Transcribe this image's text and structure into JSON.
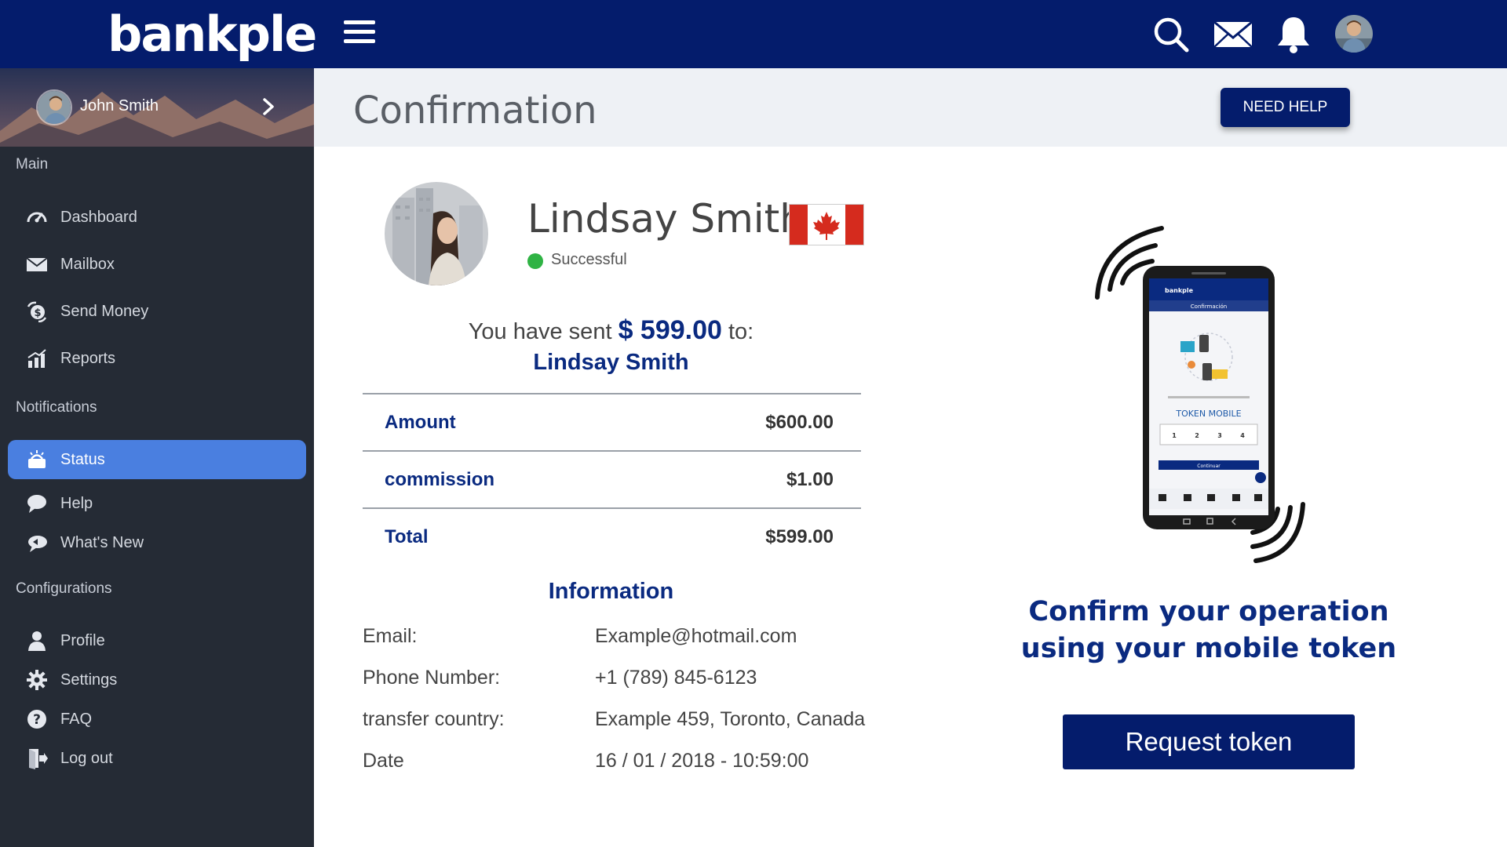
{
  "brand": {
    "logo_text": "bankple"
  },
  "topbar": {
    "icons": [
      "search-icon",
      "mail-icon",
      "bell-icon",
      "user-avatar"
    ]
  },
  "sidebar": {
    "user_name": "John Smith",
    "sections": {
      "main": "Main",
      "notifications": "Notifications",
      "configurations": "Configurations"
    },
    "items": [
      {
        "label": "Dashboard",
        "icon": "speedometer-icon"
      },
      {
        "label": "Mailbox",
        "icon": "mail-icon"
      },
      {
        "label": "Send Money",
        "icon": "money-transfer-icon"
      },
      {
        "label": "Reports",
        "icon": "bar-chart-icon"
      },
      {
        "label": "Status",
        "icon": "status-icon",
        "active": true
      },
      {
        "label": "Help",
        "icon": "chat-bubble-icon"
      },
      {
        "label": "What's New",
        "icon": "megaphone-icon"
      },
      {
        "label": "Profile",
        "icon": "user-icon"
      },
      {
        "label": "Settings",
        "icon": "gear-icon"
      },
      {
        "label": "FAQ",
        "icon": "question-icon"
      },
      {
        "label": "Log out",
        "icon": "logout-icon"
      }
    ]
  },
  "header": {
    "title": "Confirmation",
    "help_button": "NEED HELP"
  },
  "recipient": {
    "name": "Lindsay Smith",
    "status": "Successful",
    "country_flag": "canada-flag-icon"
  },
  "transfer": {
    "sent_prefix": "You have sent",
    "sent_amount": "$ 599.00",
    "sent_suffix": "to:",
    "sent_to": "Lindsay Smith"
  },
  "summary": [
    {
      "label": "Amount",
      "value": "$600.00"
    },
    {
      "label": "commission",
      "value": "$1.00"
    },
    {
      "label": "Total",
      "value": "$599.00"
    }
  ],
  "information": {
    "title": "Information",
    "rows": [
      {
        "key": "Email:",
        "value": "Example@hotmail.com"
      },
      {
        "key": "Phone Number:",
        "value": "+1 (789) 845-6123"
      },
      {
        "key": "transfer country:",
        "value": "Example 459, Toronto, Canada"
      },
      {
        "key": "Date",
        "value": "16 / 01 / 2018 -  10:59:00"
      }
    ]
  },
  "token_panel": {
    "phone_app_title": "Confirmación",
    "phone_token_label": "TOKEN MOBILE",
    "phone_digits": [
      "1",
      "2",
      "3",
      "4"
    ],
    "phone_continue": "Continuar",
    "message": "Confirm your operation using your mobile token",
    "button": "Request token"
  },
  "colors": {
    "primary": "#041c6c",
    "accent_text": "#0a2a80",
    "sidebar_bg": "#252b35",
    "active_item": "#4a7fe0",
    "success": "#2fb344"
  }
}
